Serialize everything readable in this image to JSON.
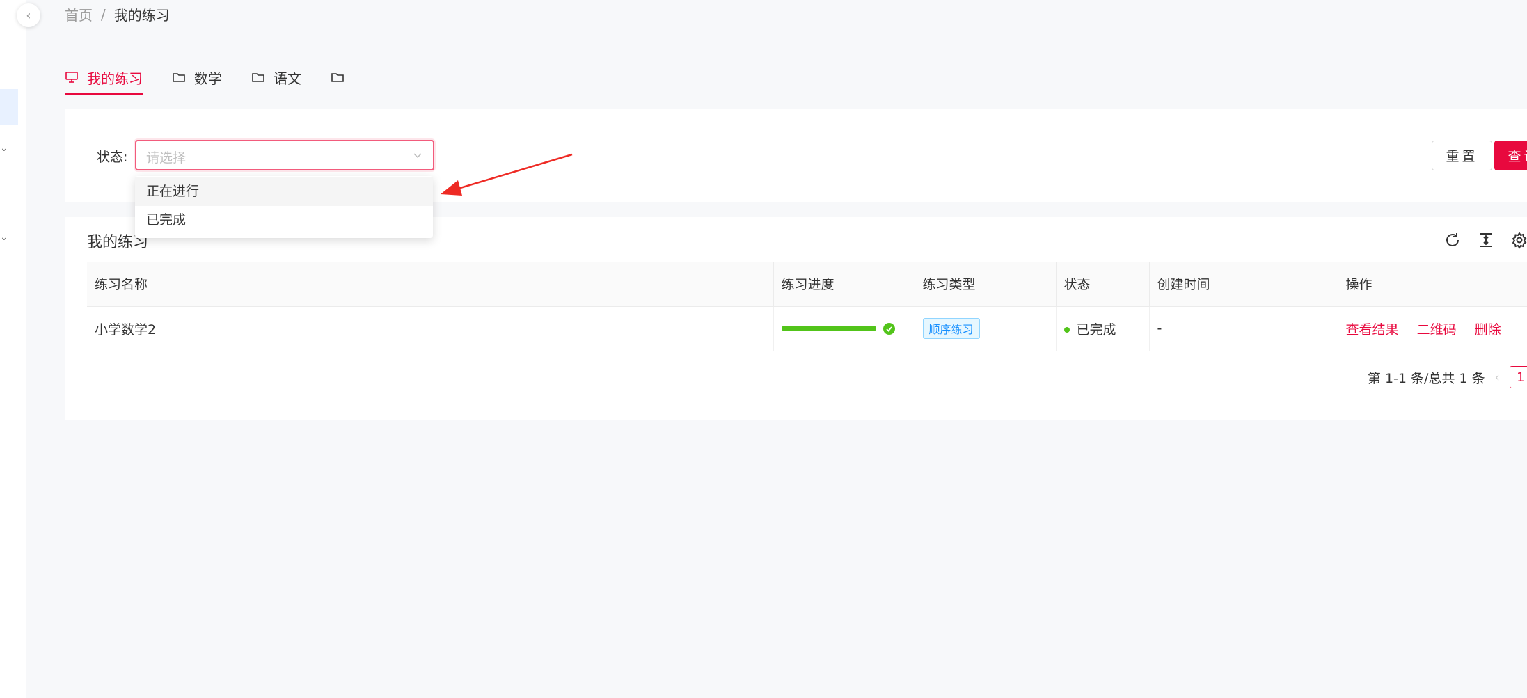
{
  "breadcrumb": {
    "home": "首页",
    "separator": "/",
    "current": "我的练习"
  },
  "tabs": [
    {
      "label": "我的练习",
      "icon": "monitor-icon",
      "active": true
    },
    {
      "label": "数学",
      "icon": "folder-icon",
      "active": false
    },
    {
      "label": "语文",
      "icon": "folder-icon",
      "active": false
    },
    {
      "label": "",
      "icon": "folder-icon",
      "active": false
    }
  ],
  "filter": {
    "status_label": "状态:",
    "status_placeholder": "请选择",
    "options": [
      "正在进行",
      "已完成"
    ],
    "reset_label": "重置",
    "query_label": "查询"
  },
  "table": {
    "title": "我的练习",
    "columns": [
      "练习名称",
      "练习进度",
      "练习类型",
      "状态",
      "创建时间",
      "操作"
    ],
    "rows": [
      {
        "name": "小学数学2",
        "progress": 1.0,
        "type": "顺序练习",
        "status": "已完成",
        "created": "-",
        "actions": [
          "查看结果",
          "二维码",
          "删除"
        ]
      }
    ]
  },
  "pagination": {
    "summary": "第 1-1 条/总共 1 条",
    "current_page": "1"
  },
  "colors": {
    "accent": "#e8093e",
    "success": "#52c41a",
    "tag_blue": "#1890ff"
  }
}
